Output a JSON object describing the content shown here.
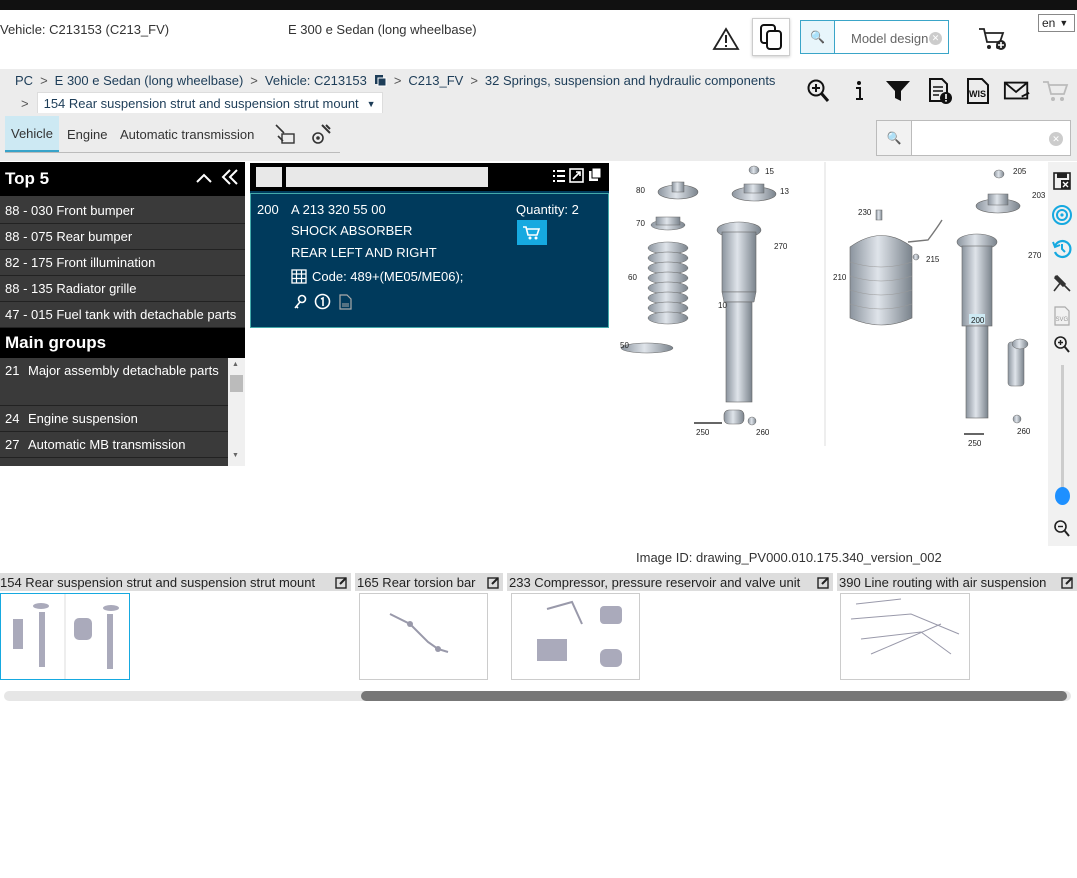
{
  "header": {
    "vehicle": "Vehicle: C213153 (C213_FV)",
    "model": "E 300 e Sedan (long wheelbase)",
    "search_placeholder": "Model design",
    "language": "en"
  },
  "breadcrumb": {
    "items": [
      "PC",
      "E 300 e Sedan (long wheelbase)",
      "Vehicle: C213153",
      "C213_FV",
      "32 Springs, suspension and hydraulic components"
    ],
    "current": "154 Rear suspension strut and suspension strut mount",
    "separator": ">"
  },
  "tabs": [
    "Vehicle",
    "Engine",
    "Automatic transmission"
  ],
  "left_panel": {
    "top5_title": "Top 5",
    "top5": [
      "88 - 030 Front bumper",
      "88 - 075 Rear bumper",
      "82 - 175 Front illumination",
      "88 - 135 Radiator grille",
      "47 - 015 Fuel tank with detachable parts"
    ],
    "main_groups_title": "Main groups",
    "main_groups": [
      {
        "num": "21",
        "label": "Major assembly detachable parts"
      },
      {
        "num": "24",
        "label": "Engine suspension"
      },
      {
        "num": "27",
        "label": "Automatic MB transmission"
      }
    ]
  },
  "part": {
    "position": "200",
    "number": "A 213 320 55 00",
    "name": "SHOCK ABSORBER",
    "side": "REAR LEFT AND RIGHT",
    "code": "Code: 489+(ME05/ME06);",
    "quantity": "Quantity: 2"
  },
  "drawing": {
    "labels_left": [
      "15",
      "80",
      "13",
      "70",
      "270",
      "60",
      "10",
      "50",
      "250",
      "260"
    ],
    "labels_right": [
      "205",
      "203",
      "230",
      "270",
      "215",
      "210",
      "200",
      "250",
      "260"
    ]
  },
  "image_id": "Image ID: drawing_PV000.010.175.340_version_002",
  "thumbnails": [
    "154 Rear suspension strut and suspension strut mount",
    "165 Rear torsion bar",
    "233 Compressor, pressure reservoir and valve unit",
    "390 Line routing with air suspension"
  ],
  "right_tools": [
    "save-icon",
    "target-icon",
    "history-icon",
    "pin-icon",
    "svg-icon",
    "zoom-in-icon",
    "zoom-out-icon"
  ],
  "colors": {
    "accent": "#16a9e0",
    "part_bg": "#003a5c",
    "panel_bg": "#3a3a3a"
  }
}
